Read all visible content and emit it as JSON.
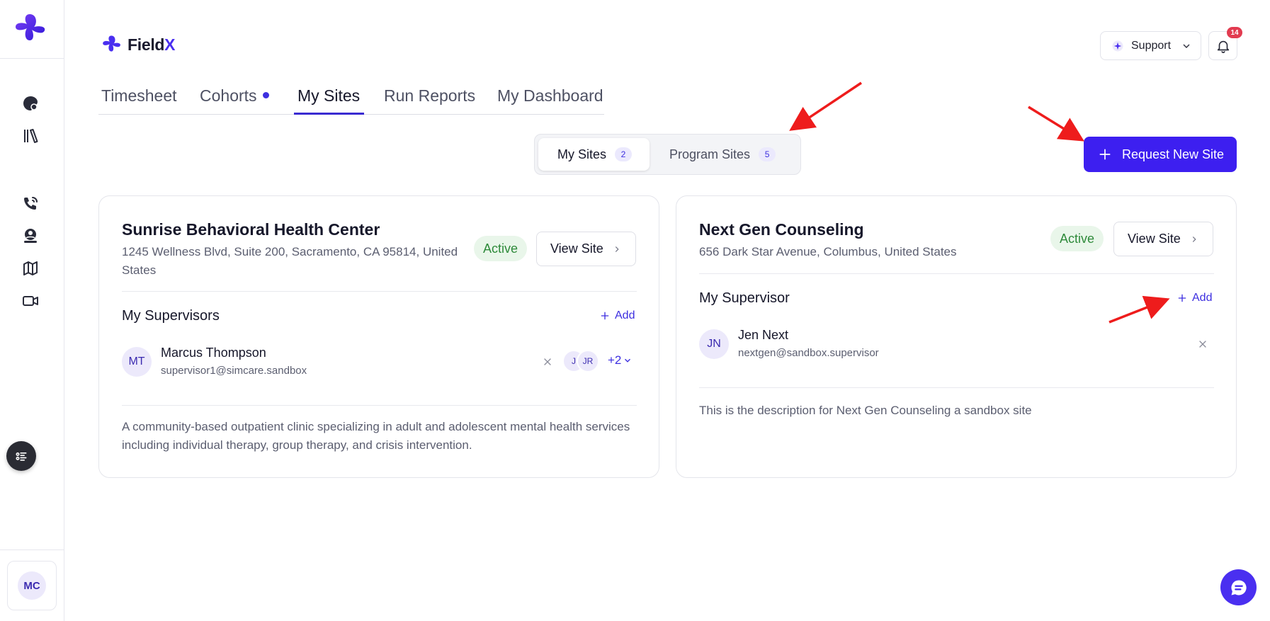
{
  "app": {
    "brand_prefix": "Field",
    "brand_suffix": "X"
  },
  "header": {
    "support_label": "Support",
    "notification_count": "14"
  },
  "tabs": [
    {
      "label": "Timesheet"
    },
    {
      "label": "Cohorts"
    },
    {
      "label": "My Sites"
    },
    {
      "label": "Run Reports"
    },
    {
      "label": "My Dashboard"
    }
  ],
  "segments": {
    "my_sites": {
      "label": "My Sites",
      "count": "2"
    },
    "program_sites": {
      "label": "Program Sites",
      "count": "5"
    }
  },
  "request_button": "Request New Site",
  "user": {
    "initials": "MC"
  },
  "sites": [
    {
      "title": "Sunrise Behavioral Health Center",
      "address": "1245 Wellness Blvd, Suite 200, Sacramento, CA 95814, United States",
      "status": "Active",
      "view_label": "View Site",
      "section_title": "My Supervisors",
      "add_label": "Add",
      "supervisor": {
        "initials": "MT",
        "name": "Marcus Thompson",
        "email": "supervisor1@simcare.sandbox"
      },
      "extra_avatars": [
        "J",
        "JR"
      ],
      "more_label": "+2",
      "description": "A community-based outpatient clinic specializing in adult and adolescent mental health services including individual therapy, group therapy, and crisis intervention."
    },
    {
      "title": "Next Gen Counseling",
      "address": "656 Dark Star Avenue, Columbus, United States",
      "status": "Active",
      "view_label": "View Site",
      "section_title": "My Supervisor",
      "add_label": "Add",
      "supervisor": {
        "initials": "JN",
        "name": "Jen Next",
        "email": "nextgen@sandbox.supervisor"
      },
      "description": "This is the description for Next Gen Counseling a sandbox site"
    }
  ],
  "colors": {
    "accent": "#3d1ff0",
    "status_green": "#2e8a3a",
    "badge_red": "#e23b50",
    "annotation_red": "#ee1c1c"
  },
  "icons": [
    "fieldx-logo-icon",
    "palette-icon",
    "library-icon",
    "phone-call-icon",
    "user-circle-icon",
    "map-icon",
    "video-icon",
    "list-icon",
    "bell-icon",
    "sparkle-icon",
    "chevron-down-icon",
    "plus-icon",
    "chevron-right-icon",
    "close-icon",
    "chat-icon"
  ]
}
